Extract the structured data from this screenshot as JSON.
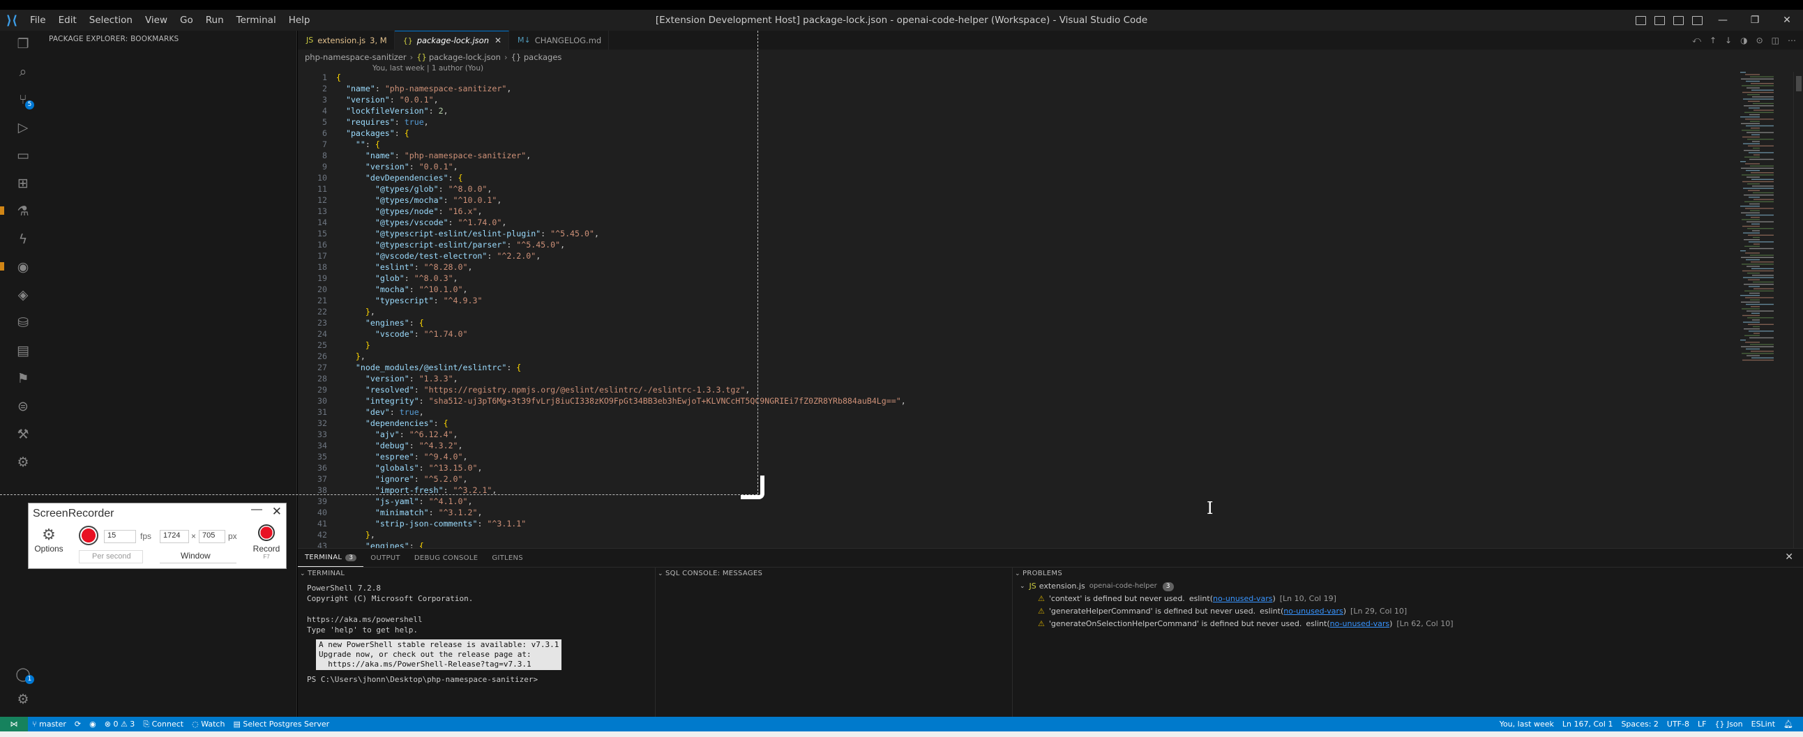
{
  "window": {
    "title": "[Extension Development Host] package-lock.json - openai-code-helper (Workspace) - Visual Studio Code",
    "menu": [
      "File",
      "Edit",
      "Selection",
      "View",
      "Go",
      "Run",
      "Terminal",
      "Help"
    ]
  },
  "sidebar": {
    "title": "PACKAGE EXPLORER: BOOKMARKS"
  },
  "activity": {
    "source_control_badge": "5",
    "accounts_badge": "1"
  },
  "tabs": [
    {
      "label": "extension.js",
      "suffix": "3, M",
      "glyph": "JS",
      "active": false
    },
    {
      "label": "package-lock.json",
      "suffix": "",
      "glyph": "{}",
      "active": true
    },
    {
      "label": "CHANGELOG.md",
      "suffix": "",
      "glyph": "M↓",
      "active": false
    }
  ],
  "breadcrumb": [
    "php-namespace-sanitizer",
    "package-lock.json",
    "{} packages"
  ],
  "codelens": "You, last week | 1 author (You)",
  "code_lines": [
    "{",
    "  \"name\": \"php-namespace-sanitizer\",",
    "  \"version\": \"0.0.1\",",
    "  \"lockfileVersion\": 2,",
    "  \"requires\": true,",
    "  \"packages\": {",
    "    \"\": {",
    "      \"name\": \"php-namespace-sanitizer\",",
    "      \"version\": \"0.0.1\",",
    "      \"devDependencies\": {",
    "        \"@types/glob\": \"^8.0.0\",",
    "        \"@types/mocha\": \"^10.0.1\",",
    "        \"@types/node\": \"16.x\",",
    "        \"@types/vscode\": \"^1.74.0\",",
    "        \"@typescript-eslint/eslint-plugin\": \"^5.45.0\",",
    "        \"@typescript-eslint/parser\": \"^5.45.0\",",
    "        \"@vscode/test-electron\": \"^2.2.0\",",
    "        \"eslint\": \"^8.28.0\",",
    "        \"glob\": \"^8.0.3\",",
    "        \"mocha\": \"^10.1.0\",",
    "        \"typescript\": \"^4.9.3\"",
    "      },",
    "      \"engines\": {",
    "        \"vscode\": \"^1.74.0\"",
    "      }",
    "    },",
    "    \"node_modules/@eslint/eslintrc\": {",
    "      \"version\": \"1.3.3\",",
    "      \"resolved\": \"https://registry.npmjs.org/@eslint/eslintrc/-/eslintrc-1.3.3.tgz\",",
    "      \"integrity\": \"sha512-uj3pT6Mg+3t39fvLrj8iuCI338zKO9FpGt34BB3eb3hEwjoT+KLVNCcHT5QC9NGRIEi7fZ0ZR8YRb884auB4Lg==\",",
    "      \"dev\": true,",
    "      \"dependencies\": {",
    "        \"ajv\": \"^6.12.4\",",
    "        \"debug\": \"^4.3.2\",",
    "        \"espree\": \"^9.4.0\",",
    "        \"globals\": \"^13.15.0\",",
    "        \"ignore\": \"^5.2.0\",",
    "        \"import-fresh\": \"^3.2.1\",",
    "        \"js-yaml\": \"^4.1.0\",",
    "        \"minimatch\": \"^3.1.2\",",
    "        \"strip-json-comments\": \"^3.1.1\"",
    "      },",
    "      \"engines\": {"
  ],
  "panel": {
    "tabs": [
      {
        "label": "TERMINAL",
        "count": "3",
        "active": true
      },
      {
        "label": "OUTPUT",
        "count": "",
        "active": false
      },
      {
        "label": "DEBUG CONSOLE",
        "count": "",
        "active": false
      },
      {
        "label": "GITLENS",
        "count": "",
        "active": false
      }
    ],
    "terminal_header": "TERMINAL",
    "sql_header": "SQL CONSOLE: MESSAGES",
    "problems_header": "PROBLEMS",
    "terminal_lines": [
      "PowerShell 7.2.8",
      "Copyright (C) Microsoft Corporation.",
      "",
      "https://aka.ms/powershell",
      "Type 'help' to get help."
    ],
    "terminal_notice": [
      "A new PowerShell stable release is available: v7.3.1",
      "Upgrade now, or check out the release page at:",
      "  https://aka.ms/PowerShell-Release?tag=v7.3.1"
    ],
    "terminal_prompt": "PS C:\\Users\\jhonn\\Desktop\\php-namespace-sanitizer>",
    "problems_file": {
      "name": "extension.js",
      "dir": "openai-code-helper",
      "count": "3"
    },
    "problems": [
      {
        "msg": "'context' is defined but never used.",
        "source": "eslint",
        "rule": "no-unused-vars",
        "loc": "[Ln 10, Col 19]"
      },
      {
        "msg": "'generateHelperCommand' is defined but never used.",
        "source": "eslint",
        "rule": "no-unused-vars",
        "loc": "[Ln 29, Col 10]"
      },
      {
        "msg": "'generateOnSelectionHelperCommand' is defined but never used.",
        "source": "eslint",
        "rule": "no-unused-vars",
        "loc": "[Ln 62, Col 10]"
      }
    ]
  },
  "status": {
    "branch": "master",
    "problems": "⊗ 0 ⚠ 3",
    "connect": "Connect",
    "watch": "Watch",
    "postgres": "Select Postgres Server",
    "blame": "You, last week",
    "position": "Ln 167, Col 1",
    "spaces": "Spaces: 2",
    "encoding": "UTF-8",
    "eol": "LF",
    "language": "{} Json",
    "linter": "ESLint"
  },
  "recorder": {
    "title": "ScreenRecorder",
    "options_label": "Options",
    "fps_value": "15",
    "fps_label": "fps",
    "width": "1724",
    "height": "705",
    "times": "×",
    "px_label": "px",
    "per_second": "Per second",
    "window_label": "Window",
    "record_label": "Record",
    "record_hint": "F7"
  }
}
